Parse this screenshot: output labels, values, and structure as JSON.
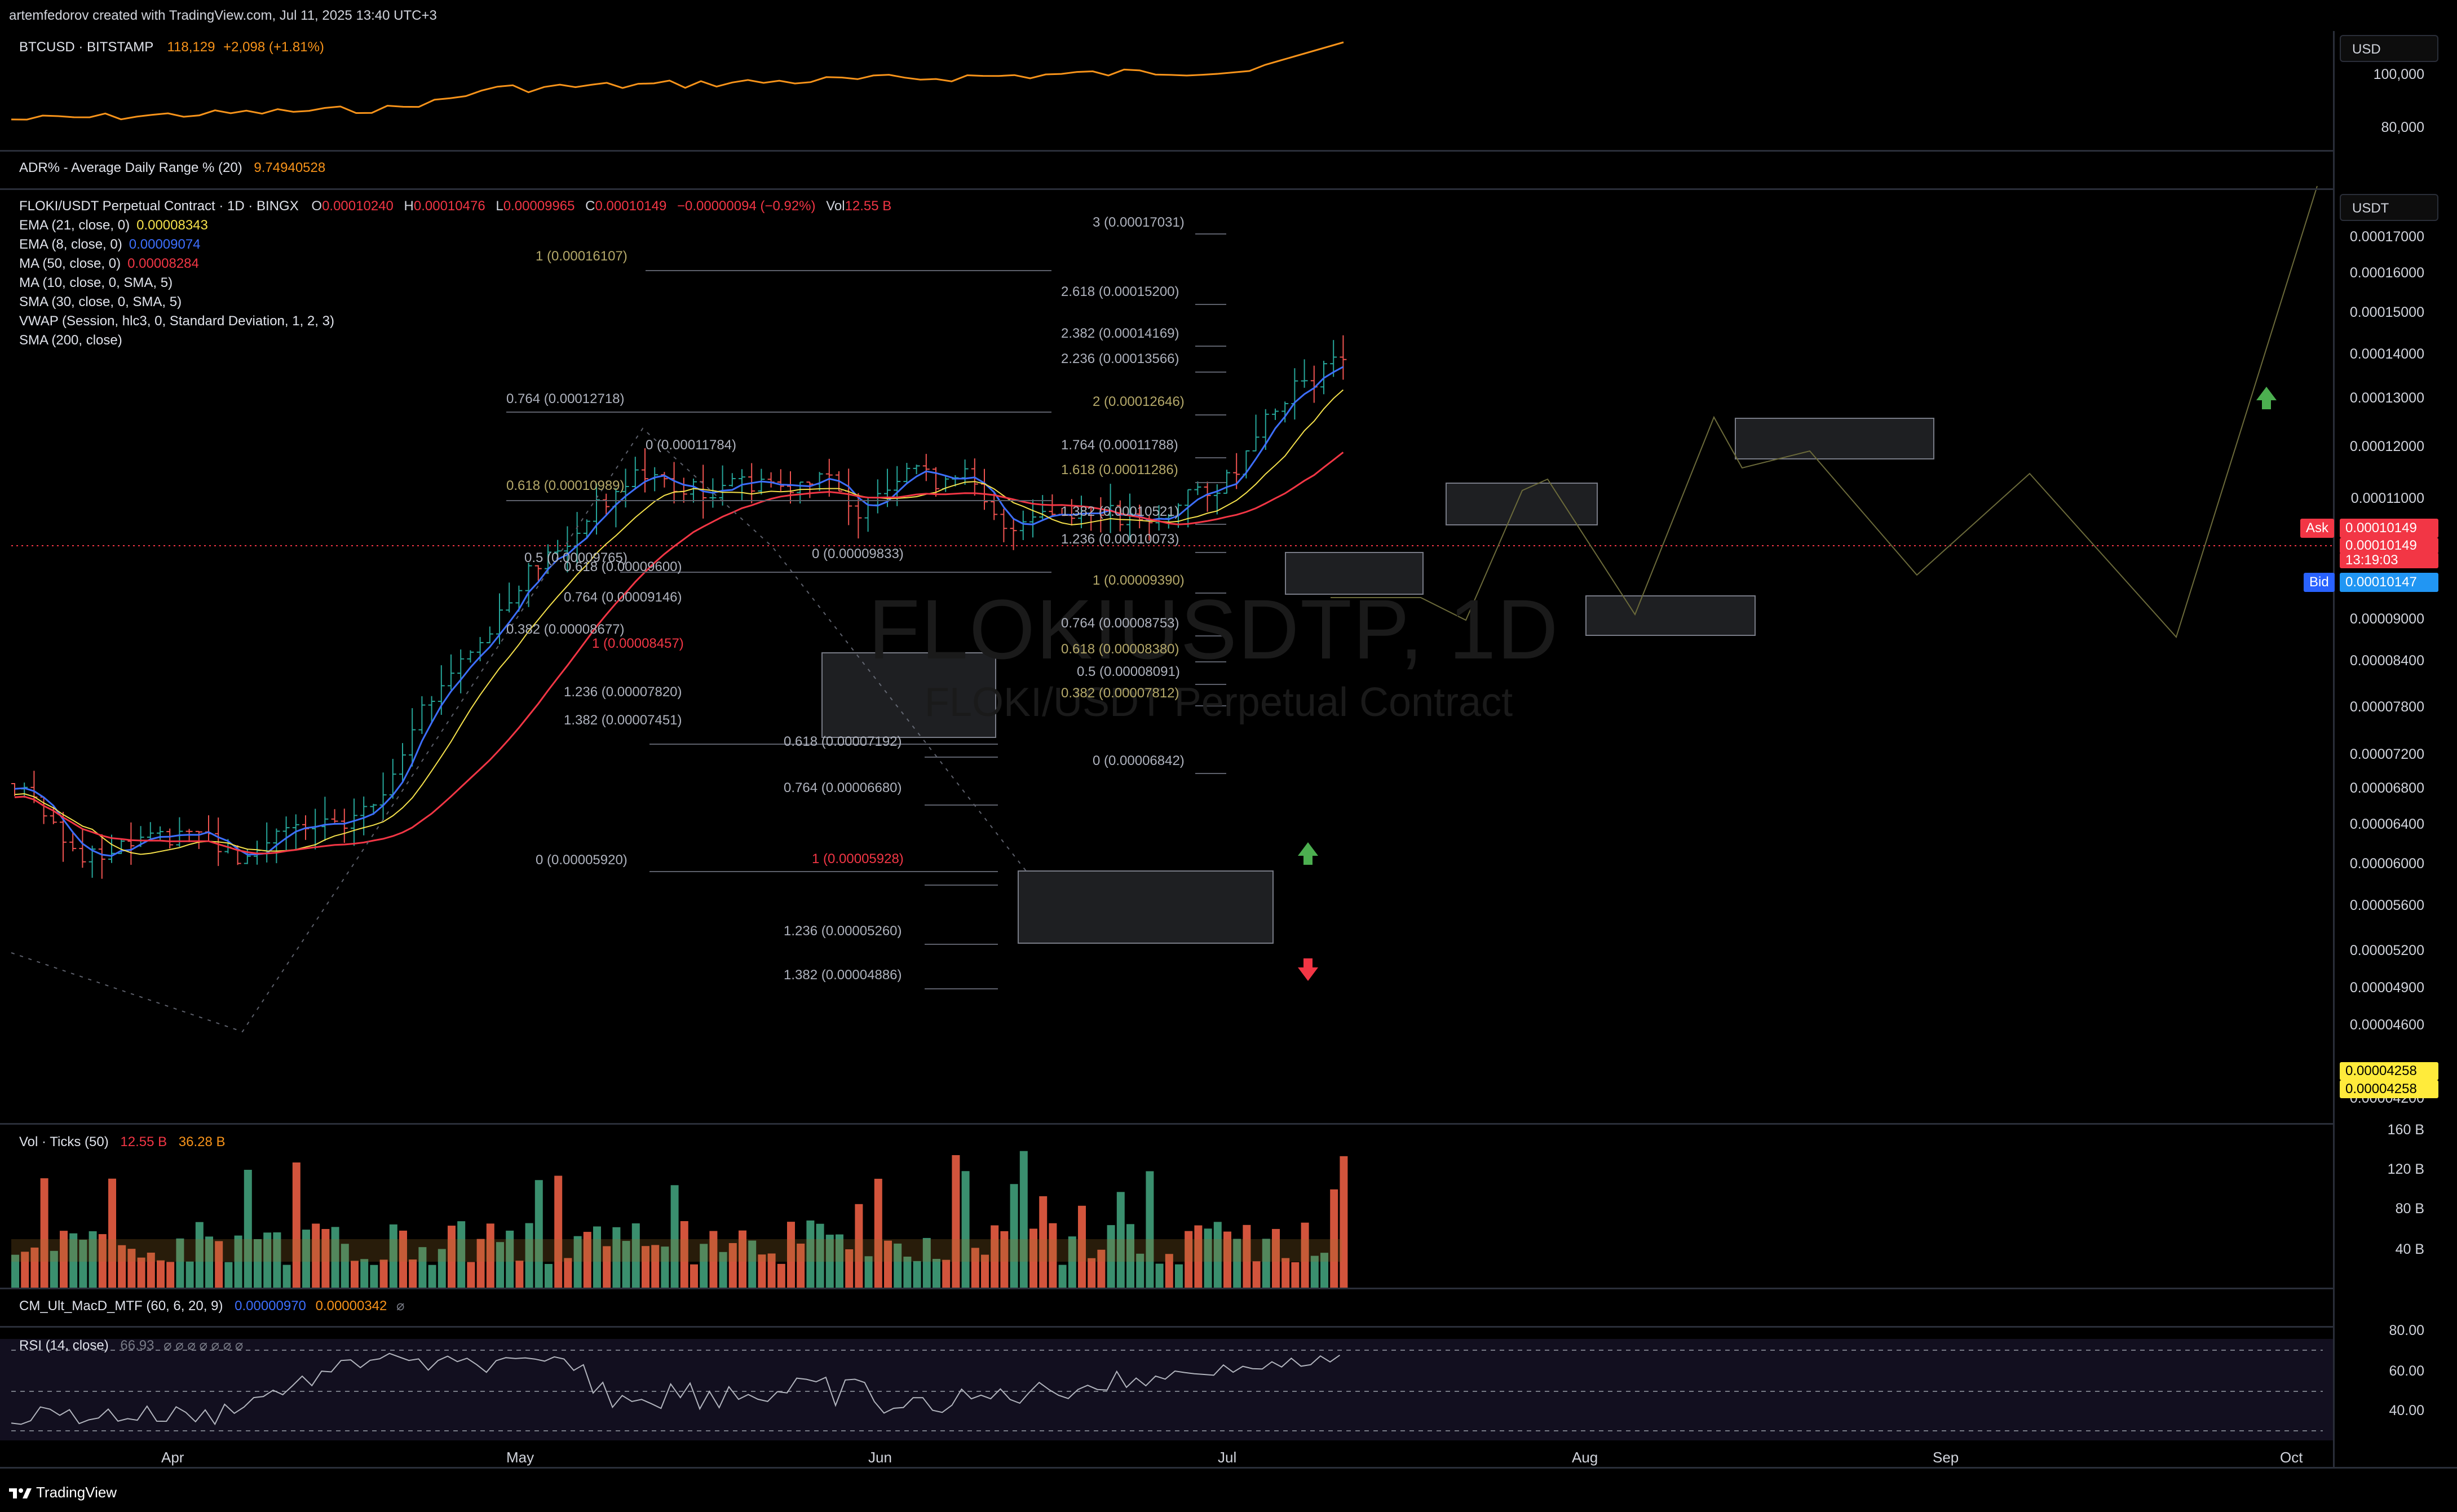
{
  "header": {
    "credit": "artemfedorov created with TradingView.com, Jul 11, 2025 13:40 UTC+3"
  },
  "btc_pane": {
    "symbol": "BTCUSD · BITSTAMP",
    "price": "118,129",
    "change": "+2,098 (+1.81%)",
    "currency_button": "USD",
    "axis": [
      "100,000",
      "80,000"
    ],
    "line_color": "#f7931a"
  },
  "adr_pane": {
    "label": "ADR% - Average Daily Range % (20)",
    "value": "9.74940528"
  },
  "main_pane": {
    "title": "FLOKI/USDT Perpetual Contract · 1D · BINGX",
    "ohlc": {
      "o_label": "O",
      "o": "0.00010240",
      "h_label": "H",
      "h": "0.00010476",
      "l_label": "L",
      "l": "0.00009965",
      "c_label": "C",
      "c": "0.00010149",
      "chg": "−0.00000094 (−0.92%)",
      "vol_label": "Vol",
      "vol": "12.55 B"
    },
    "indicators": [
      {
        "label": "EMA (21, close, 0)",
        "value": "0.00008343",
        "color": "#f5e14b"
      },
      {
        "label": "EMA (8, close, 0)",
        "value": "0.00009074",
        "color": "#3d6fff"
      },
      {
        "label": "MA (50, close, 0)",
        "value": "0.00008284",
        "color": "#f23645"
      },
      {
        "label": "MA (10, close, 0, SMA, 5)",
        "value": "",
        "color": "#d1d4dc"
      },
      {
        "label": "SMA (30, close, 0, SMA, 5)",
        "value": "",
        "color": "#d1d4dc"
      },
      {
        "label": "VWAP (Session, hlc3, 0, Standard Deviation, 1, 2, 3)",
        "value": "",
        "color": "#d1d4dc"
      },
      {
        "label": "SMA (200, close)",
        "value": "",
        "color": "#d1d4dc"
      }
    ],
    "currency_button": "USDT",
    "watermark_symbol": "FLOKIUSDTP, 1D",
    "watermark_name": "FLOKI/USDT Perpetual Contract",
    "price_axis": [
      "0.00017000",
      "0.00016000",
      "0.00015000",
      "0.00014000",
      "0.00013000",
      "0.00012000",
      "0.00011000",
      "0.00010000",
      "0.00009000",
      "0.00008400",
      "0.00007800",
      "0.00007200",
      "0.00006800",
      "0.00006400",
      "0.00006000",
      "0.00005600",
      "0.00005200",
      "0.00004900",
      "0.00004600",
      "0.00004200"
    ],
    "ask_label": "Ask",
    "ask_price": "0.00010149",
    "last_price": "0.00010149",
    "countdown": "13:19:03",
    "bid_label": "Bid",
    "bid_price": "0.00010147",
    "low_tag_1": "0.00004258",
    "low_tag_2": "0.00004258",
    "fib_left": [
      {
        "text": "1 (0.00016107)",
        "color": "#b5a96a"
      },
      {
        "text": "0.764 (0.00012718)",
        "color": "#aeb2bd"
      },
      {
        "text": "0.618 (0.00010989)",
        "color": "#b5a96a"
      },
      {
        "text": "0.5 (0.00009765)",
        "color": "#aeb2bd"
      },
      {
        "text": "0.382 (0.00008677)",
        "color": "#aeb2bd"
      },
      {
        "text": "0 (0.00005920)",
        "color": "#aeb2bd"
      }
    ],
    "fib_mid": [
      {
        "text": "0 (0.00011784)",
        "color": "#aeb2bd"
      },
      {
        "text": "0.618 (0.00009600)",
        "color": "#aeb2bd"
      },
      {
        "text": "0.764 (0.00009146)",
        "color": "#aeb2bd"
      },
      {
        "text": "1 (0.00008457)",
        "color": "#f23645"
      },
      {
        "text": "1.236 (0.00007820)",
        "color": "#aeb2bd"
      },
      {
        "text": "1.382 (0.00007451)",
        "color": "#aeb2bd"
      },
      {
        "text": "0 (0.00009833)",
        "color": "#aeb2bd"
      },
      {
        "text": "0.618 (0.00007192)",
        "color": "#aeb2bd"
      },
      {
        "text": "0.764 (0.00006680)",
        "color": "#aeb2bd"
      },
      {
        "text": "1 (0.00005928)",
        "color": "#f23645"
      },
      {
        "text": "1.236 (0.00005260)",
        "color": "#aeb2bd"
      },
      {
        "text": "1.382 (0.00004886)",
        "color": "#aeb2bd"
      }
    ],
    "fib_right": [
      {
        "text": "3 (0.00017031)",
        "color": "#aeb2bd"
      },
      {
        "text": "2.618 (0.00015200)",
        "color": "#aeb2bd"
      },
      {
        "text": "2.382 (0.00014169)",
        "color": "#aeb2bd"
      },
      {
        "text": "2.236 (0.00013566)",
        "color": "#aeb2bd"
      },
      {
        "text": "2 (0.00012646)",
        "color": "#b5a96a"
      },
      {
        "text": "1.764 (0.00011788)",
        "color": "#aeb2bd"
      },
      {
        "text": "1.618 (0.00011286)",
        "color": "#b5a96a"
      },
      {
        "text": "1.382 (0.00010521)",
        "color": "#aeb2bd"
      },
      {
        "text": "1.236 (0.00010073)",
        "color": "#aeb2bd"
      },
      {
        "text": "1 (0.00009390)",
        "color": "#b5a96a"
      },
      {
        "text": "0.764 (0.00008753)",
        "color": "#aeb2bd"
      },
      {
        "text": "0.618 (0.00008380)",
        "color": "#b5a96a"
      },
      {
        "text": "0.5 (0.00008091)",
        "color": "#aeb2bd"
      },
      {
        "text": "0.382 (0.00007812)",
        "color": "#b5a96a"
      },
      {
        "text": "0 (0.00006842)",
        "color": "#aeb2bd"
      }
    ]
  },
  "volume_pane": {
    "label": "Vol · Ticks (50)",
    "value1": "12.55 B",
    "value2": "36.28 B",
    "axis": [
      "160 B",
      "120 B",
      "80 B",
      "40 B"
    ]
  },
  "macd_pane": {
    "label": "CM_Ult_MacD_MTF (60, 6, 20, 9)",
    "value1": "0.00000970",
    "value2": "0.00000342",
    "extra": "⌀"
  },
  "rsi_pane": {
    "label": "RSI (14, close)",
    "value": "66.93",
    "extra": "⌀ ⌀ ⌀ ⌀ ⌀ ⌀ ⌀",
    "axis": [
      "80.00",
      "60.00",
      "40.00"
    ]
  },
  "time_axis": [
    "Apr",
    "May",
    "Jun",
    "Jul",
    "Aug",
    "Sep",
    "Oct"
  ],
  "footer": {
    "brand": "TradingView"
  }
}
